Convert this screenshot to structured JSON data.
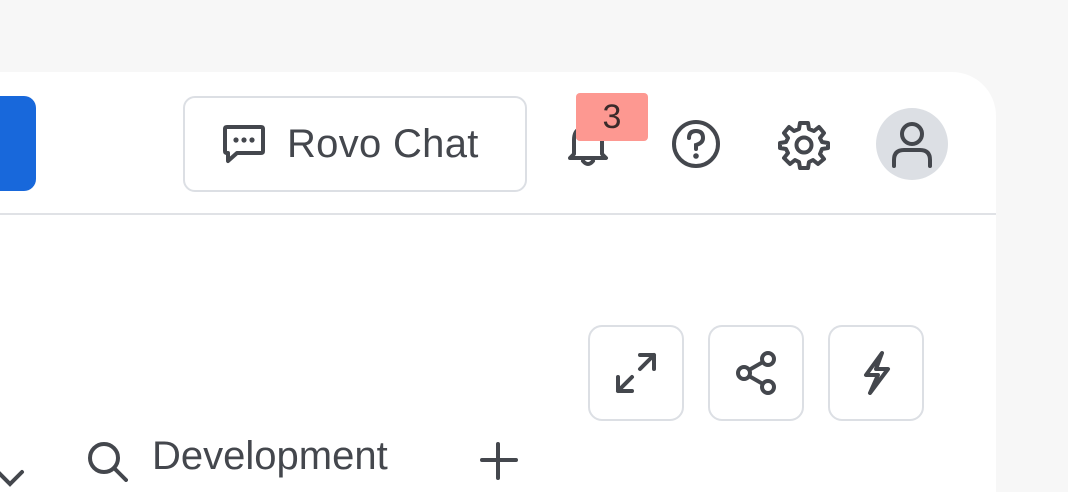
{
  "header": {
    "rovo_chat_label": "Rovo Chat",
    "notifications_count": "3"
  },
  "toolbar": {
    "tools": [
      "expand",
      "share",
      "automation"
    ]
  },
  "bottom": {
    "item_label": "Development"
  },
  "icons": {
    "rovo": "chat-bubble-icon",
    "notifications": "bell-icon",
    "help": "help-icon",
    "settings": "gear-icon",
    "avatar": "user-icon",
    "expand": "expand-icon",
    "share": "share-icon",
    "automation": "lightning-icon"
  },
  "colors": {
    "primary": "#1868db",
    "badge": "#fd9891",
    "panel": "#ffffff",
    "background": "#f7f7f7"
  }
}
